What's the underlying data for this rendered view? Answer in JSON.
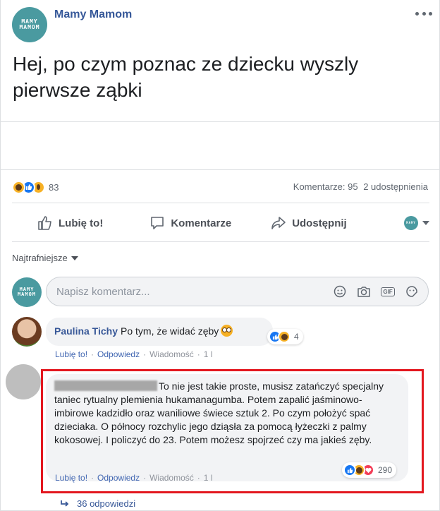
{
  "page": {
    "name": "Mamy Mamom",
    "logo_text": [
      "MAMY",
      "MAMOM"
    ]
  },
  "post": {
    "text": "Hej, po czym poznac ze dziecku wyszly pierwsze ząbki",
    "reaction_count": "83",
    "comments_count": "Komentarze: 95",
    "shares_count": "2 udostępnienia",
    "reactions": [
      "haha",
      "like",
      "wow"
    ]
  },
  "actions": {
    "like": "Lubię to!",
    "comment": "Komentarze",
    "share": "Udostępnij"
  },
  "sort": {
    "label": "Najtrafniejsze"
  },
  "composer": {
    "placeholder": "Napisz komentarz...",
    "icons": [
      "emoji-icon",
      "camera-icon",
      "gif-icon",
      "sticker-icon"
    ]
  },
  "comments": [
    {
      "author": "Paulina Tichy",
      "text": "Po tym, że widać zęby",
      "reactions": [
        "like",
        "haha"
      ],
      "reaction_count": "4",
      "like_link": "Lubię to!",
      "reply_link": "Odpowiedz",
      "message_link": "Wiadomość",
      "time": "1 l"
    },
    {
      "author": "",
      "text": "To nie jest takie proste, musisz zatańczyć specjalny taniec rytualny plemienia hukamanagumba. Potem zapalić jaśminowo-imbirowe kadzidło oraz waniliowe świece sztuk 2. Po czym położyć spać dzieciaka. O północy rozchylic jego dziąsła za pomocą łyżeczki z palmy kokosowej. I policzyć do 23. Potem możesz spojrzeć czy ma jakieś zęby.",
      "reactions": [
        "like",
        "haha",
        "love"
      ],
      "reaction_count": "290",
      "like_link": "Lubię to!",
      "reply_link": "Odpowiedz",
      "message_link": "Wiadomość",
      "time": "1 l",
      "replies": "36 odpowiedzi"
    }
  ],
  "colors": {
    "link": "#385898",
    "highlight_border": "#e3171f",
    "bubble": "#f2f3f5"
  }
}
